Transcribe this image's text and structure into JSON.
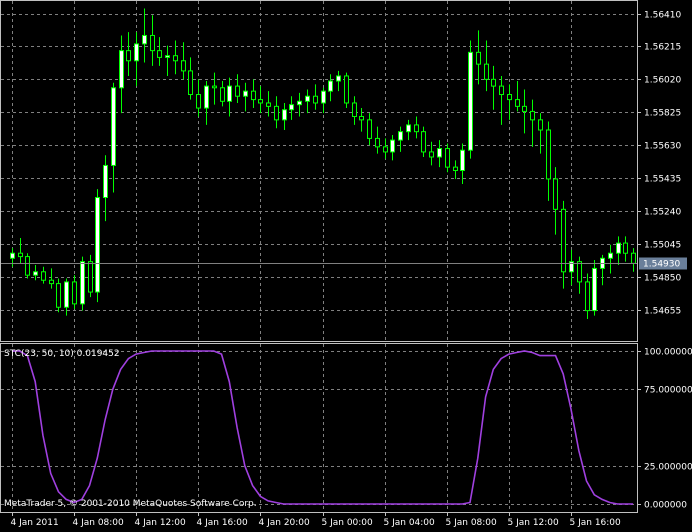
{
  "colors": {
    "background": "#000000",
    "grid": "#808080",
    "border": "#c0c0c0",
    "text": "#ffffff",
    "bull_candle": "#00ff00",
    "bull_body": "#ffffff",
    "bear_body": "#000000",
    "indicator_line": "#a040e0",
    "bid_line": "#808080",
    "price_tag_bg": "#6a7f9a"
  },
  "chart_data": [
    {
      "type": "candlestick",
      "symbol_interval": "",
      "ylim": [
        1.5447,
        1.5649
      ],
      "y_ticks": [
        "1.56410",
        "1.56215",
        "1.56020",
        "1.55825",
        "1.55630",
        "1.55435",
        "1.55240",
        "1.55045",
        "1.54850",
        "1.54655"
      ],
      "y_tick_values": [
        1.5641,
        1.56215,
        1.5602,
        1.55825,
        1.5563,
        1.55435,
        1.5524,
        1.55045,
        1.5485,
        1.54655
      ],
      "current_price_label": "1.54930",
      "current_price": 1.5493,
      "candles": [
        [
          1.5496,
          1.5502,
          1.5491,
          1.5499
        ],
        [
          1.5499,
          1.5508,
          1.5493,
          1.5497
        ],
        [
          1.5497,
          1.5499,
          1.5484,
          1.5486
        ],
        [
          1.5486,
          1.5492,
          1.5483,
          1.5488
        ],
        [
          1.5488,
          1.5491,
          1.5481,
          1.5483
        ],
        [
          1.5483,
          1.549,
          1.5478,
          1.5481
        ],
        [
          1.5481,
          1.5484,
          1.5464,
          1.5467
        ],
        [
          1.5467,
          1.5484,
          1.5462,
          1.5482
        ],
        [
          1.5482,
          1.5486,
          1.5466,
          1.5469
        ],
        [
          1.5469,
          1.5497,
          1.5465,
          1.5494
        ],
        [
          1.5494,
          1.5498,
          1.5473,
          1.5476
        ],
        [
          1.5476,
          1.5537,
          1.547,
          1.5532
        ],
        [
          1.5532,
          1.5557,
          1.5518,
          1.5551
        ],
        [
          1.5551,
          1.56,
          1.5535,
          1.5597
        ],
        [
          1.5597,
          1.5628,
          1.5582,
          1.5619
        ],
        [
          1.5619,
          1.563,
          1.5604,
          1.5613
        ],
        [
          1.5613,
          1.563,
          1.5598,
          1.5623
        ],
        [
          1.5623,
          1.5644,
          1.5612,
          1.5628
        ],
        [
          1.5628,
          1.564,
          1.561,
          1.5619
        ],
        [
          1.5619,
          1.5627,
          1.561,
          1.5615
        ],
        [
          1.5615,
          1.5622,
          1.5604,
          1.5616
        ],
        [
          1.5616,
          1.5625,
          1.5605,
          1.5613
        ],
        [
          1.5613,
          1.5624,
          1.5602,
          1.5607
        ],
        [
          1.5607,
          1.5615,
          1.559,
          1.5593
        ],
        [
          1.5593,
          1.5602,
          1.558,
          1.5585
        ],
        [
          1.5585,
          1.5601,
          1.5575,
          1.5598
        ],
        [
          1.5598,
          1.5606,
          1.5587,
          1.5597
        ],
        [
          1.5597,
          1.5601,
          1.5586,
          1.5589
        ],
        [
          1.5589,
          1.5603,
          1.558,
          1.5598
        ],
        [
          1.5598,
          1.5605,
          1.5588,
          1.5592
        ],
        [
          1.5592,
          1.56,
          1.5583,
          1.5595
        ],
        [
          1.5595,
          1.5602,
          1.5585,
          1.559
        ],
        [
          1.559,
          1.5598,
          1.5582,
          1.5588
        ],
        [
          1.5588,
          1.5595,
          1.558,
          1.5586
        ],
        [
          1.5586,
          1.5592,
          1.5573,
          1.5578
        ],
        [
          1.5578,
          1.5588,
          1.5572,
          1.5584
        ],
        [
          1.5584,
          1.5592,
          1.5578,
          1.5587
        ],
        [
          1.5587,
          1.5594,
          1.558,
          1.5589
        ],
        [
          1.5589,
          1.5596,
          1.5582,
          1.5592
        ],
        [
          1.5592,
          1.5599,
          1.5584,
          1.5588
        ],
        [
          1.5588,
          1.5597,
          1.5582,
          1.5595
        ],
        [
          1.5595,
          1.5605,
          1.5589,
          1.5601
        ],
        [
          1.5601,
          1.5607,
          1.5595,
          1.5604
        ],
        [
          1.5604,
          1.5606,
          1.5585,
          1.5588
        ],
        [
          1.5588,
          1.5592,
          1.5575,
          1.558
        ],
        [
          1.558,
          1.5585,
          1.5571,
          1.5578
        ],
        [
          1.5578,
          1.5582,
          1.5563,
          1.5567
        ],
        [
          1.5567,
          1.5574,
          1.5558,
          1.5562
        ],
        [
          1.5562,
          1.5567,
          1.5555,
          1.5559
        ],
        [
          1.5559,
          1.5569,
          1.5554,
          1.5566
        ],
        [
          1.5566,
          1.5574,
          1.5559,
          1.5571
        ],
        [
          1.5571,
          1.5578,
          1.5566,
          1.5575
        ],
        [
          1.5575,
          1.558,
          1.5567,
          1.5571
        ],
        [
          1.5571,
          1.5574,
          1.5556,
          1.5559
        ],
        [
          1.5559,
          1.5565,
          1.5551,
          1.5556
        ],
        [
          1.5556,
          1.5566,
          1.555,
          1.5561
        ],
        [
          1.5561,
          1.5564,
          1.5547,
          1.555
        ],
        [
          1.555,
          1.5554,
          1.5543,
          1.5548
        ],
        [
          1.5548,
          1.5564,
          1.554,
          1.556
        ],
        [
          1.556,
          1.5625,
          1.5555,
          1.5618
        ],
        [
          1.5618,
          1.5631,
          1.5599,
          1.5611
        ],
        [
          1.5611,
          1.5625,
          1.5595,
          1.5602
        ],
        [
          1.5602,
          1.561,
          1.5584,
          1.5598
        ],
        [
          1.5598,
          1.5604,
          1.5575,
          1.5593
        ],
        [
          1.5593,
          1.5599,
          1.5578,
          1.559
        ],
        [
          1.559,
          1.5601,
          1.5583,
          1.5586
        ],
        [
          1.5586,
          1.5596,
          1.557,
          1.5583
        ],
        [
          1.5583,
          1.559,
          1.5562,
          1.5578
        ],
        [
          1.5578,
          1.5582,
          1.5558,
          1.5572
        ],
        [
          1.5572,
          1.5577,
          1.553,
          1.5543
        ],
        [
          1.5543,
          1.555,
          1.551,
          1.5525
        ],
        [
          1.5525,
          1.553,
          1.5478,
          1.5488
        ],
        [
          1.5488,
          1.5501,
          1.548,
          1.5494
        ],
        [
          1.5494,
          1.5497,
          1.5475,
          1.5482
        ],
        [
          1.5482,
          1.5487,
          1.546,
          1.5465
        ],
        [
          1.5465,
          1.5495,
          1.5462,
          1.549
        ],
        [
          1.549,
          1.5498,
          1.548,
          1.5496
        ],
        [
          1.5496,
          1.5504,
          1.5487,
          1.5499
        ],
        [
          1.5499,
          1.5509,
          1.5492,
          1.5505
        ],
        [
          1.5505,
          1.5509,
          1.5494,
          1.5499
        ],
        [
          1.5499,
          1.5502,
          1.5488,
          1.5493
        ]
      ]
    },
    {
      "type": "line",
      "indicator_label": "STC(23, 50, 10) 0.019452",
      "ylim": [
        0,
        100
      ],
      "y_ticks": [
        "100.000000",
        "75.000000",
        "25.000000",
        "0.000000"
      ],
      "y_tick_values": [
        100,
        75,
        25,
        0
      ],
      "series": [
        {
          "values": [
            100,
            100,
            97,
            80,
            45,
            20,
            8,
            3,
            1,
            3,
            12,
            30,
            55,
            75,
            88,
            95,
            98,
            99,
            100,
            100,
            100,
            100,
            100,
            100,
            100,
            100,
            100,
            98,
            80,
            50,
            25,
            12,
            5,
            2,
            1,
            0,
            0,
            0,
            0,
            0,
            0,
            0,
            0,
            0,
            0,
            0,
            0,
            0,
            0,
            0,
            0,
            0,
            0,
            0,
            0,
            0,
            0,
            0,
            0,
            1,
            30,
            70,
            88,
            95,
            98,
            99,
            100,
            99,
            97,
            97,
            97,
            85,
            62,
            35,
            15,
            6,
            3,
            1,
            0,
            0,
            0
          ]
        }
      ],
      "x_tick_labels": [
        "4 Jan 2011",
        "4 Jan 08:00",
        "4 Jan 12:00",
        "4 Jan 16:00",
        "4 Jan 20:00",
        "5 Jan 00:00",
        "5 Jan 04:00",
        "5 Jan 08:00",
        "5 Jan 12:00",
        "5 Jan 16:00"
      ],
      "x_tick_index": [
        0,
        8,
        16,
        24,
        32,
        40,
        48,
        56,
        64,
        72
      ]
    }
  ],
  "copyright": "MetaTrader 5, © 2001-2010 MetaQuotes Software Corp."
}
